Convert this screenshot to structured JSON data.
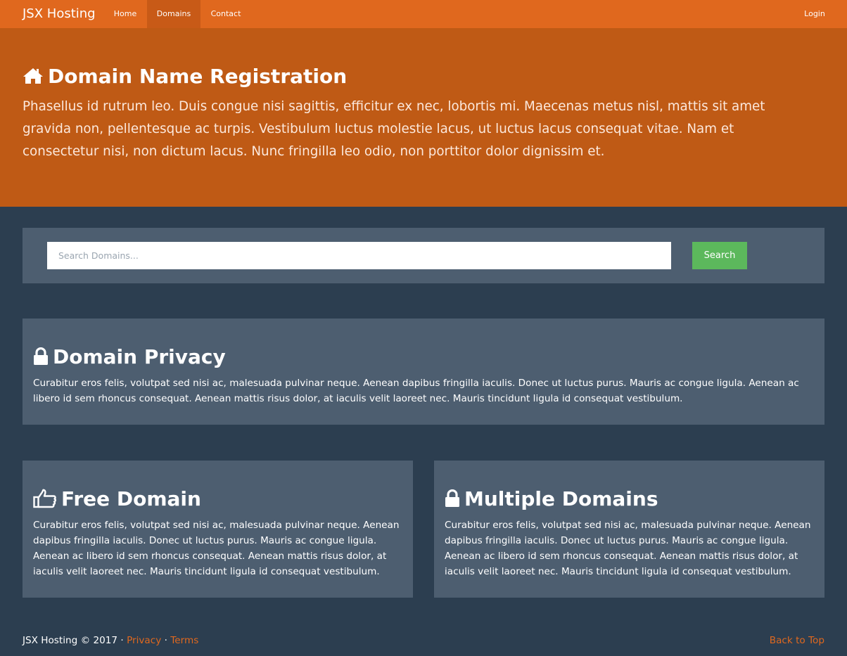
{
  "nav": {
    "brand": "JSX Hosting",
    "items": [
      {
        "label": "Home"
      },
      {
        "label": "Domains",
        "active": true
      },
      {
        "label": "Contact"
      }
    ],
    "login": "Login"
  },
  "hero": {
    "icon": "home-icon",
    "title": "Domain Name Registration",
    "text": "Phasellus id rutrum leo. Duis congue nisi sagittis, efficitur ex nec, lobortis mi. Maecenas metus nisl, mattis sit amet gravida non, pellentesque ac turpis. Vestibulum luctus molestie lacus, ut luctus lacus consequat vitae. Nam et consectetur nisi, non dictum lacus. Nunc fringilla leo odio, non porttitor dolor dignissim et."
  },
  "search": {
    "placeholder": "Search Domains...",
    "value": "",
    "button": "Search"
  },
  "cards": [
    {
      "icon": "lock-icon",
      "title": "Domain Privacy",
      "text": "Curabitur eros felis, volutpat sed nisi ac, malesuada pulvinar neque. Aenean dapibus fringilla iaculis. Donec ut luctus purus. Mauris ac congue ligula. Aenean ac libero id sem rhoncus consequat. Aenean mattis risus dolor, at iaculis velit laoreet nec. Mauris tincidunt ligula id consequat vestibulum."
    },
    {
      "icon": "thumbs-up-icon",
      "title": "Free Domain",
      "text": "Curabitur eros felis, volutpat sed nisi ac, malesuada pulvinar neque. Aenean dapibus fringilla iaculis. Donec ut luctus purus. Mauris ac congue ligula. Aenean ac libero id sem rhoncus consequat. Aenean mattis risus dolor, at iaculis velit laoreet nec. Mauris tincidunt ligula id consequat vestibulum."
    },
    {
      "icon": "lock-icon",
      "title": "Multiple Domains",
      "text": "Curabitur eros felis, volutpat sed nisi ac, malesuada pulvinar neque. Aenean dapibus fringilla iaculis. Donec ut luctus purus. Mauris ac congue ligula. Aenean ac libero id sem rhoncus consequat. Aenean mattis risus dolor, at iaculis velit laoreet nec. Mauris tincidunt ligula id consequat vestibulum."
    }
  ],
  "footer": {
    "copyright": "JSX Hosting © 2017",
    "separator": "·",
    "privacy": "Privacy",
    "terms": "Terms",
    "back_to_top": "Back to Top"
  },
  "colors": {
    "navbar": "#e0681e",
    "nav_active": "#c85a17",
    "hero": "#bf5a15",
    "page_bg": "#2c3e50",
    "panel": "#4d5e70",
    "search_button": "#5cb85c",
    "link": "#e0681e"
  }
}
